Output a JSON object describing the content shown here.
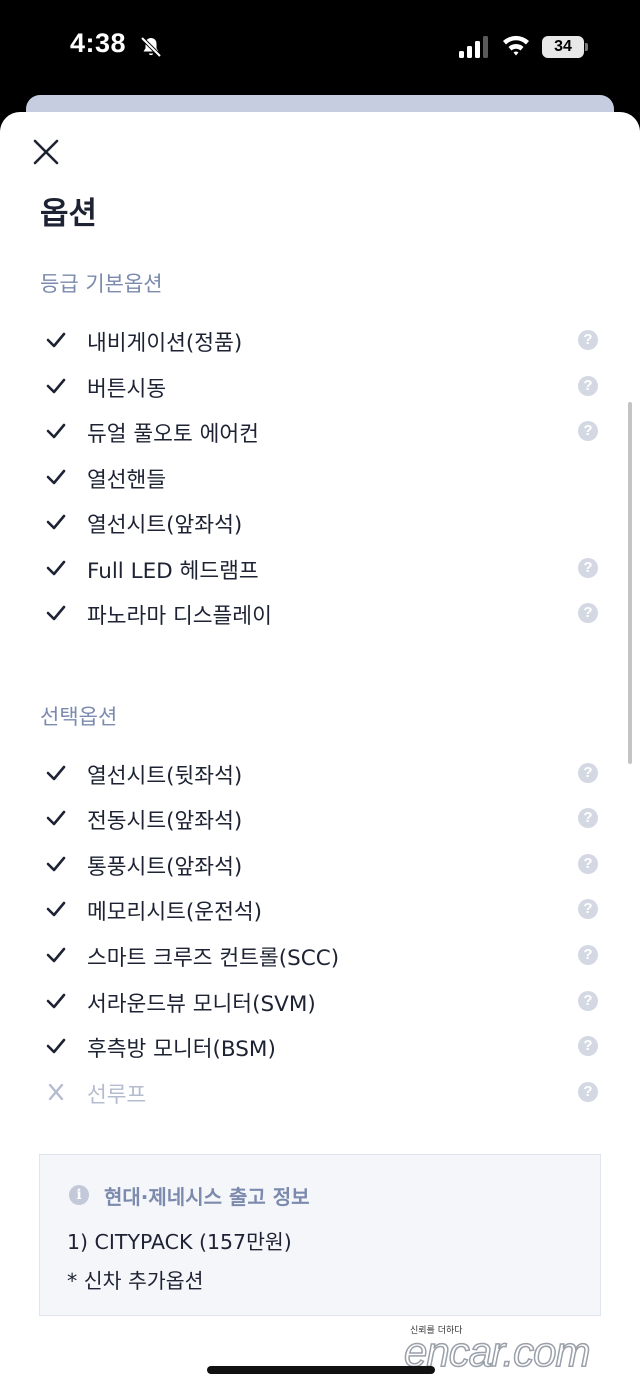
{
  "status_bar": {
    "time": "4:38",
    "battery": "34",
    "icons": [
      "bell-muted-icon",
      "signal-icon",
      "wifi-icon",
      "battery-icon"
    ]
  },
  "header": {
    "title": "옵션",
    "close_icon": "close-icon"
  },
  "sections": {
    "basic": {
      "title": "등급 기본옵션",
      "items": [
        {
          "label": "내비게이션(정품)",
          "help": "?"
        },
        {
          "label": "버튼시동",
          "help": "?"
        },
        {
          "label": "듀얼 풀오토 에어컨",
          "help": "?"
        },
        {
          "label": "열선핸들"
        },
        {
          "label": "열선시트(앞좌석)"
        },
        {
          "label": "Full LED 헤드램프",
          "help": "?"
        },
        {
          "label": "파노라마 디스플레이",
          "help": "?"
        }
      ]
    },
    "selected": {
      "title": "선택옵션",
      "items": [
        {
          "label": "열선시트(뒷좌석)",
          "help": "?"
        },
        {
          "label": "전동시트(앞좌석)",
          "help": "?"
        },
        {
          "label": "통풍시트(앞좌석)",
          "help": "?"
        },
        {
          "label": "메모리시트(운전석)",
          "help": "?"
        },
        {
          "label": "스마트 크루즈 컨트롤(SCC)",
          "help": "?"
        },
        {
          "label": "서라운드뷰 모니터(SVM)",
          "help": "?"
        },
        {
          "label": "후측방 모니터(BSM)",
          "help": "?"
        },
        {
          "label": "선루프",
          "help": "?",
          "disabled": true
        }
      ]
    }
  },
  "info_box": {
    "icon": "i",
    "title": "현대·제네시스 출고 정보",
    "lines": [
      "1) CITYPACK (157만원)",
      "* 신차 추가옵션"
    ]
  },
  "watermark": {
    "tagline": "신뢰를 더하다",
    "brand": "encar.com"
  },
  "colors": {
    "text": "#1d2333",
    "section": "#7b8aad",
    "disabled": "#b4bccf",
    "help": "#d3d8e2"
  }
}
